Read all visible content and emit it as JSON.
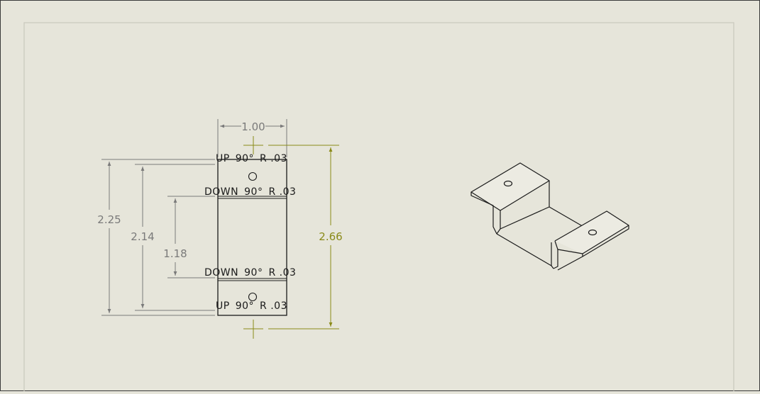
{
  "flat_pattern": {
    "bend_notes": [
      {
        "direction": "UP",
        "angle": "90°",
        "radius": "R .03"
      },
      {
        "direction": "DOWN",
        "angle": "90°",
        "radius": "R .03"
      },
      {
        "direction": "DOWN",
        "angle": "90°",
        "radius": "R .03"
      },
      {
        "direction": "UP",
        "angle": "90°",
        "radius": "R .03"
      }
    ],
    "dimensions": {
      "width": "1.00",
      "overall_bounding": "2.66",
      "length_outer": "2.25",
      "length_mid": "2.14",
      "length_inner": "1.18"
    }
  },
  "colors": {
    "sheet_background": "#e6e5da",
    "outline": "#1a1a1a",
    "dimension_gray": "#7a7a7a",
    "dimension_olive": "#8a8a18"
  }
}
